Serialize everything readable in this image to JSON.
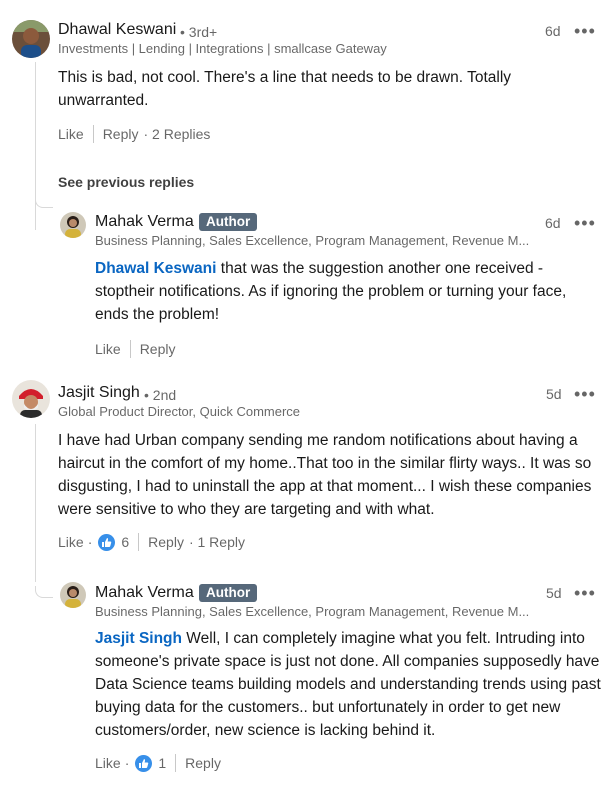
{
  "comments": [
    {
      "author": "Dhawal Keswani",
      "degree": "• 3rd+",
      "headline": "Investments | Lending | Integrations | smallcase Gateway",
      "time": "6d",
      "body": "This is bad, not cool. There's a line that needs to be drawn. Totally unwarranted.",
      "actions": {
        "like": "Like",
        "reply": "Reply",
        "replies": "· 2 Replies"
      },
      "see_previous": "See previous replies",
      "reply": {
        "author": "Mahak Verma",
        "badge": "Author",
        "headline": "Business Planning, Sales Excellence, Program Management, Revenue M...",
        "time": "6d",
        "mention": "Dhawal Keswani",
        "body": " that was the suggestion another one received - stoptheir notifications. As if ignoring the problem or turning your face, ends the problem!",
        "actions": {
          "like": "Like",
          "reply": "Reply"
        }
      }
    },
    {
      "author": "Jasjit Singh",
      "degree": "• 2nd",
      "headline": "Global Product Director, Quick Commerce",
      "time": "5d",
      "body": "I have had Urban company sending me random notifications about having a haircut in the comfort of my home..That too in the similar flirty ways.. It was so disgusting, I had to uninstall the app at that moment... I wish these companies were sensitive to who they are targeting and with what.",
      "actions": {
        "like": "Like",
        "dot": "·",
        "reactions": "6",
        "reply": "Reply",
        "replies": "· 1 Reply"
      },
      "reply": {
        "author": "Mahak Verma",
        "badge": "Author",
        "headline": "Business Planning, Sales Excellence, Program Management, Revenue M...",
        "time": "5d",
        "mention": "Jasjit Singh",
        "body": " Well, I can completely imagine what you felt. Intruding into someone's private space is just not done. All companies supposedly have Data Science teams building models and understanding trends using past buying data for the customers.. but unfortunately in order to get new customers/order, new science is lacking behind it.",
        "actions": {
          "like": "Like",
          "dot": "·",
          "reactions": "1",
          "reply": "Reply"
        }
      }
    }
  ],
  "icons": {
    "more": "more-options-icon",
    "reaction": "thumbs-up-reaction-icon"
  },
  "colors": {
    "mention": "#0a66c2",
    "badge": "#56687a",
    "reaction": "#378fe9"
  },
  "more_glyph": "•••"
}
